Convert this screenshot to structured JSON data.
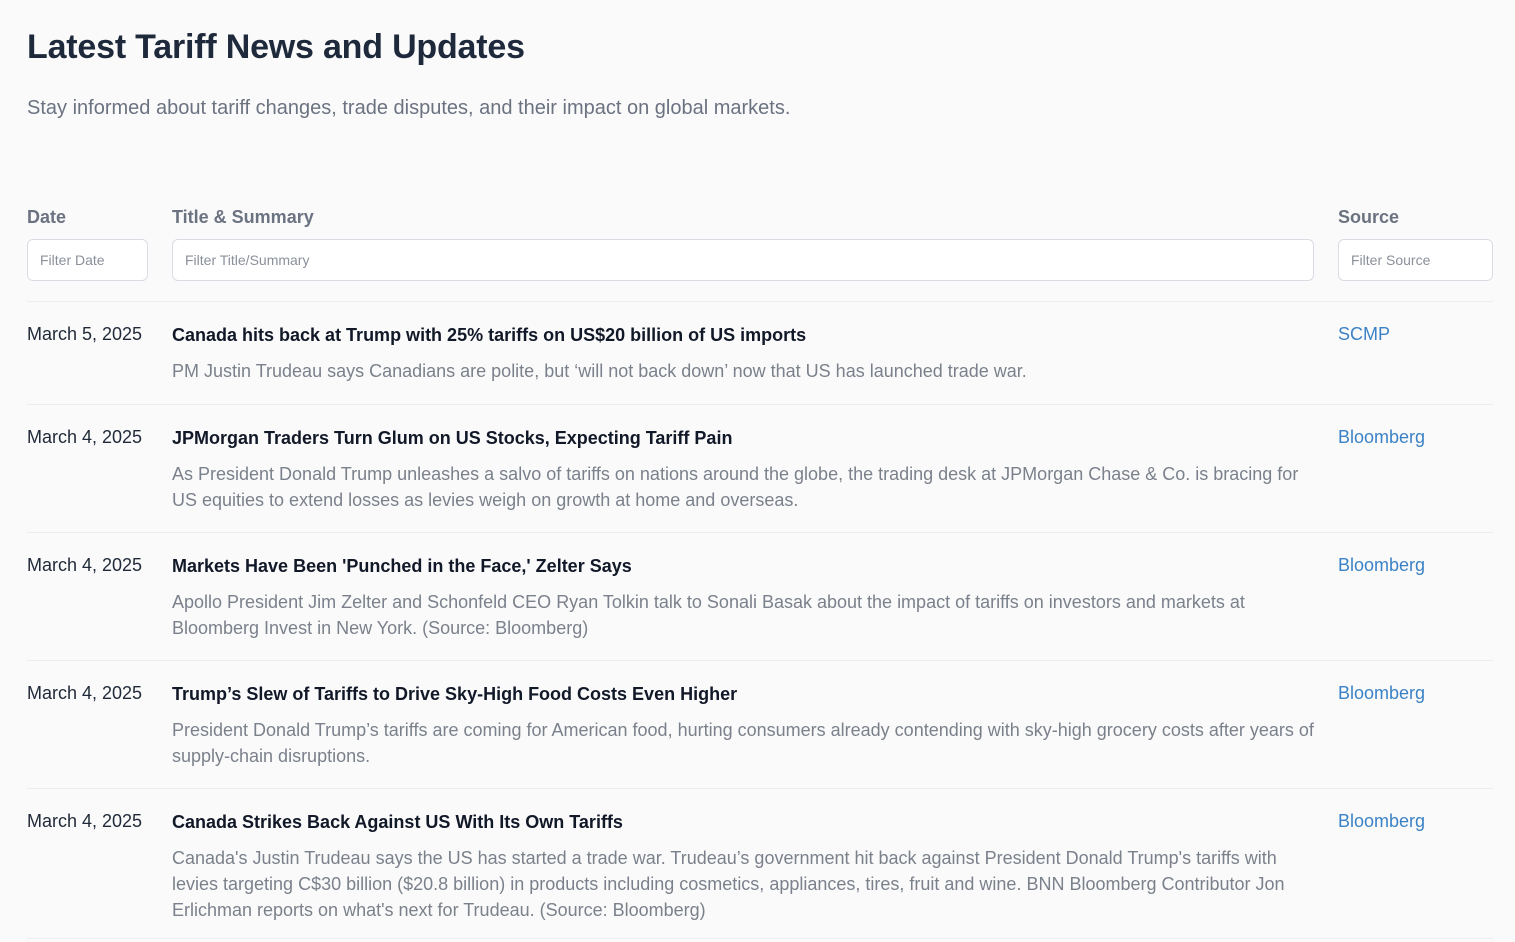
{
  "header": {
    "title": "Latest Tariff News and Updates",
    "subtitle": "Stay informed about tariff changes, trade disputes, and their impact on global markets."
  },
  "table": {
    "columns": {
      "date": "Date",
      "title_summary": "Title & Summary",
      "source": "Source"
    },
    "filters": {
      "date_placeholder": "Filter Date",
      "title_placeholder": "Filter Title/Summary",
      "source_placeholder": "Filter Source"
    },
    "rows": [
      {
        "date": "March 5, 2025",
        "title": "Canada hits back at Trump with 25% tariffs on US$20 billion of US imports",
        "summary": "PM Justin Trudeau says Canadians are polite, but ‘will not back down’ now that US has launched trade war.",
        "source": "SCMP"
      },
      {
        "date": "March 4, 2025",
        "title": "JPMorgan Traders Turn Glum on US Stocks, Expecting Tariff Pain",
        "summary": "As President Donald Trump unleashes a salvo of tariffs on nations around the globe, the trading desk at JPMorgan Chase & Co. is bracing for US equities to extend losses as levies weigh on growth at home and overseas.",
        "source": "Bloomberg"
      },
      {
        "date": "March 4, 2025",
        "title": "Markets Have Been 'Punched in the Face,' Zelter Says",
        "summary": "Apollo President Jim Zelter and Schonfeld CEO Ryan Tolkin talk to Sonali Basak about the impact of tariffs on investors and markets at Bloomberg Invest in New York. (Source: Bloomberg)",
        "source": "Bloomberg"
      },
      {
        "date": "March 4, 2025",
        "title": "Trump’s Slew of Tariffs to Drive Sky-High Food Costs Even Higher",
        "summary": "President Donald Trump’s tariffs are coming for American food, hurting consumers already contending with sky-high grocery costs after years of supply-chain disruptions.",
        "source": "Bloomberg"
      },
      {
        "date": "March 4, 2025",
        "title": "Canada Strikes Back Against US With Its Own Tariffs",
        "summary": "Canada's Justin Trudeau says the US has started a trade war. Trudeau’s government hit back against President Donald Trump's tariffs with levies targeting C$30 billion ($20.8 billion) in products including cosmetics, appliances, tires, fruit and wine. BNN Bloomberg Contributor Jon Erlichman reports on what's next for Trudeau. (Source: Bloomberg)",
        "source": "Bloomberg"
      }
    ]
  }
}
